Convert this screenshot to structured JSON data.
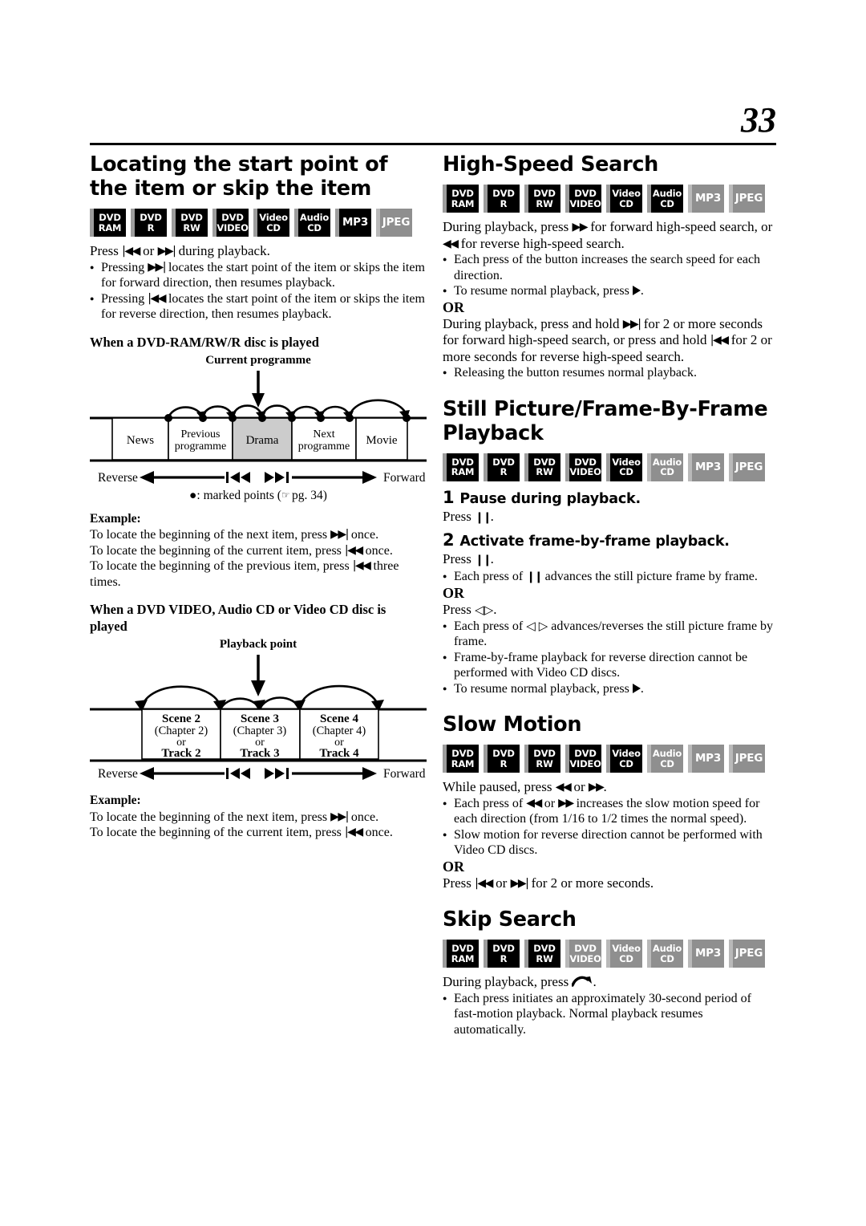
{
  "page": {
    "number": "33"
  },
  "left": {
    "heading": "Locating the start point of the item or skip the item",
    "discs": [
      {
        "l1": "DVD",
        "l2": "RAM",
        "state": "on"
      },
      {
        "l1": "DVD",
        "l2": "R",
        "state": "on"
      },
      {
        "l1": "DVD",
        "l2": "RW",
        "state": "on"
      },
      {
        "l1": "DVD",
        "l2": "VIDEO",
        "state": "on"
      },
      {
        "l1": "Video",
        "l2": "CD",
        "state": "on"
      },
      {
        "l1": "Audio",
        "l2": "CD",
        "state": "on"
      },
      {
        "l1": "",
        "l2": "MP3",
        "state": "on"
      },
      {
        "l1": "",
        "l2": "JPEG",
        "state": "off"
      }
    ],
    "intro": "during playback.",
    "intro_pre": "Press",
    "intro_or": "or",
    "bullets": [
      "locates the start point of the item or skips the item for forward direction, then resumes playback.",
      "locates the start point of the item or skips the item for reverse direction, then resumes playback."
    ],
    "bullet_pre": "Pressing",
    "sub1": "When a DVD-RAM/RW/R disc is played",
    "fig1": {
      "caption": "Current programme",
      "blocks": [
        "News",
        "Previous programme",
        "Drama",
        "Next programme",
        "Movie"
      ],
      "highlight": "Drama",
      "reverse": "Reverse",
      "forward": "Forward",
      "note": ": marked points (      pg. 34)",
      "note_bullet": "●",
      "note_text": ": marked points (",
      "note_page": " pg. 34)"
    },
    "example1": {
      "label": "Example:",
      "lines": [
        {
          "pre": "To locate the beginning of the next item, press",
          "glyph": "ffwd",
          "post": "once."
        },
        {
          "pre": "To locate the beginning of the current item, press",
          "glyph": "rew",
          "post": "once."
        },
        {
          "pre": "To locate the beginning of the previous item, press",
          "glyph": "rew",
          "post": "three times."
        }
      ]
    },
    "sub2": "When a DVD VIDEO, Audio CD or Video CD disc is played",
    "fig2": {
      "caption": "Playback point",
      "scenes": [
        {
          "scene": "Scene 2",
          "chapter": "(Chapter 2)",
          "or": "or",
          "track": "Track 2"
        },
        {
          "scene": "Scene 3",
          "chapter": "(Chapter 3)",
          "or": "or",
          "track": "Track 3"
        },
        {
          "scene": "Scene 4",
          "chapter": "(Chapter 4)",
          "or": "or",
          "track": "Track 4"
        }
      ],
      "reverse": "Reverse",
      "forward": "Forward"
    },
    "example2": {
      "label": "Example:",
      "lines": [
        {
          "pre": "To locate the beginning of the next item, press",
          "glyph": "ffwd",
          "post": "once."
        },
        {
          "pre": "To locate the beginning of the current item, press",
          "glyph": "rew",
          "post": "once."
        }
      ]
    }
  },
  "right": {
    "high_speed": {
      "heading": "High-Speed Search",
      "discs": [
        {
          "l1": "DVD",
          "l2": "RAM",
          "state": "on"
        },
        {
          "l1": "DVD",
          "l2": "R",
          "state": "on"
        },
        {
          "l1": "DVD",
          "l2": "RW",
          "state": "on"
        },
        {
          "l1": "DVD",
          "l2": "VIDEO",
          "state": "on"
        },
        {
          "l1": "Video",
          "l2": "CD",
          "state": "on"
        },
        {
          "l1": "Audio",
          "l2": "CD",
          "state": "on"
        },
        {
          "l1": "",
          "l2": "MP3",
          "state": "off"
        },
        {
          "l1": "",
          "l2": "JPEG",
          "state": "off"
        }
      ],
      "p1_a": "During playback, press",
      "p1_b": "for forward high-speed search, or",
      "p1_c": "for reverse high-speed search.",
      "b1": "Each press of the button increases the search speed for each direction.",
      "b2_pre": "To resume normal playback, press",
      "b2_post": ".",
      "or": "OR",
      "p2_a": "During playback, press and hold",
      "p2_b": "for 2 or more seconds for forward high-speed search, or press and hold",
      "p2_c": "for 2 or more seconds for reverse high-speed search.",
      "b3": "Releasing the button resumes normal playback."
    },
    "still_picture": {
      "heading": "Still Picture/Frame-By-Frame Playback",
      "discs": [
        {
          "l1": "DVD",
          "l2": "RAM",
          "state": "on"
        },
        {
          "l1": "DVD",
          "l2": "R",
          "state": "on"
        },
        {
          "l1": "DVD",
          "l2": "RW",
          "state": "on"
        },
        {
          "l1": "DVD",
          "l2": "VIDEO",
          "state": "on"
        },
        {
          "l1": "Video",
          "l2": "CD",
          "state": "on"
        },
        {
          "l1": "Audio",
          "l2": "CD",
          "state": "off"
        },
        {
          "l1": "",
          "l2": "MP3",
          "state": "off"
        },
        {
          "l1": "",
          "l2": "JPEG",
          "state": "off"
        }
      ],
      "step1_num": "1",
      "step1": "Pause during playback.",
      "step1_press_pre": "Press",
      "step1_press_post": ".",
      "step2_num": "2",
      "step2": "Activate frame-by-frame playback.",
      "step2_press_pre": "Press",
      "step2_press_post": ".",
      "b1_pre": "Each press of",
      "b1_post": "advances the still picture frame by frame.",
      "or": "OR",
      "press_arrows_pre": "Press",
      "press_arrows_post": ".",
      "b2_pre": "Each press of",
      "b2_post": "advances/reverses the still picture frame by frame.",
      "b3": "Frame-by-frame playback for reverse direction cannot be performed with Video CD discs.",
      "b4_pre": "To resume normal playback, press",
      "b4_post": "."
    },
    "slow_motion": {
      "heading": "Slow Motion",
      "discs": [
        {
          "l1": "DVD",
          "l2": "RAM",
          "state": "on"
        },
        {
          "l1": "DVD",
          "l2": "R",
          "state": "on"
        },
        {
          "l1": "DVD",
          "l2": "RW",
          "state": "on"
        },
        {
          "l1": "DVD",
          "l2": "VIDEO",
          "state": "on"
        },
        {
          "l1": "Video",
          "l2": "CD",
          "state": "on"
        },
        {
          "l1": "Audio",
          "l2": "CD",
          "state": "off"
        },
        {
          "l1": "",
          "l2": "MP3",
          "state": "off"
        },
        {
          "l1": "",
          "l2": "JPEG",
          "state": "off"
        }
      ],
      "p1_a": "While paused, press",
      "p1_b": "or",
      "p1_c": ".",
      "b1_a": "Each press of",
      "b1_b": "or",
      "b1_c": "increases the slow motion speed for each direction (from 1/16 to 1/2 times the normal speed).",
      "b2": "Slow motion for reverse direction cannot be performed with Video CD discs.",
      "or": "OR",
      "p2_a": "Press",
      "p2_b": "or",
      "p2_c": "for 2 or more seconds."
    },
    "skip_search": {
      "heading": "Skip Search",
      "discs": [
        {
          "l1": "DVD",
          "l2": "RAM",
          "state": "on"
        },
        {
          "l1": "DVD",
          "l2": "R",
          "state": "on"
        },
        {
          "l1": "DVD",
          "l2": "RW",
          "state": "on"
        },
        {
          "l1": "DVD",
          "l2": "VIDEO",
          "state": "off"
        },
        {
          "l1": "Video",
          "l2": "CD",
          "state": "off"
        },
        {
          "l1": "Audio",
          "l2": "CD",
          "state": "off"
        },
        {
          "l1": "",
          "l2": "MP3",
          "state": "off"
        },
        {
          "l1": "",
          "l2": "JPEG",
          "state": "off"
        }
      ],
      "p1_pre": "During playback, press",
      "p1_post": ".",
      "b1": "Each press initiates an approximately 30-second period of fast-motion playback. Normal playback resumes automatically."
    }
  },
  "colors": {
    "ink": "#000000",
    "disc_on": "#000000",
    "disc_off": "#8f8f8f",
    "highlight": "#cccccc"
  }
}
